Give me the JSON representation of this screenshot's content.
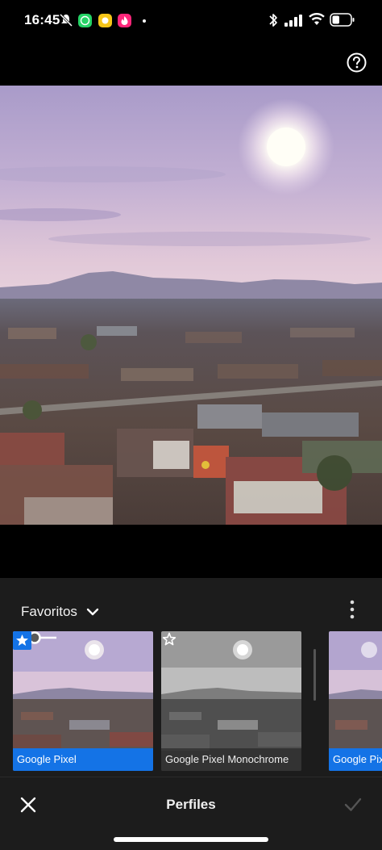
{
  "status_bar": {
    "time": "16:45",
    "icons": [
      "mute-icon",
      "whatsapp-icon",
      "yellow-app-icon",
      "tinder-icon",
      "bluetooth-icon",
      "signal-icon",
      "wifi-icon",
      "battery-icon"
    ]
  },
  "top_bar": {
    "help_icon": "question-circle-icon"
  },
  "panel": {
    "group_label": "Favoritos",
    "profiles": [
      {
        "label": "Google Pixel",
        "selected": true,
        "favorite": true
      },
      {
        "label": "Google Pixel Monochrome",
        "selected": false,
        "favorite": false
      },
      {
        "label": "Google Pixel",
        "selected": false,
        "favorite": false
      }
    ]
  },
  "bottom_bar": {
    "title": "Perfiles",
    "close_icon": "close-icon",
    "confirm_icon": "check-icon"
  },
  "colors": {
    "accent": "#1473e6",
    "panel_bg": "#1c1c1c"
  }
}
